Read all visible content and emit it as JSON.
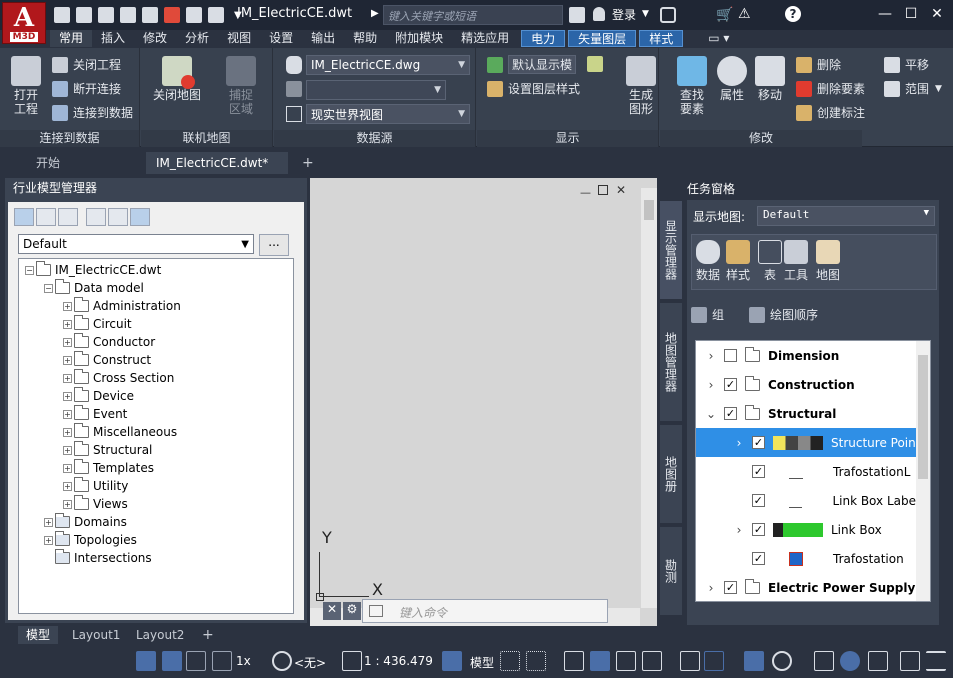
{
  "app": {
    "logo_letter": "A",
    "logo_sub": "M3D",
    "doc_title": "IM_ElectricCE.dwt",
    "search_placeholder": "键入关键字或短语",
    "signin_label": "登录"
  },
  "ribbon_tabs": [
    {
      "label": "常用",
      "active": true
    },
    {
      "label": "插入"
    },
    {
      "label": "修改"
    },
    {
      "label": "分析"
    },
    {
      "label": "视图"
    },
    {
      "label": "设置"
    },
    {
      "label": "输出"
    },
    {
      "label": "帮助"
    },
    {
      "label": "附加模块"
    },
    {
      "label": "精选应用"
    },
    {
      "label": "电力",
      "contextual": true
    },
    {
      "label": "矢量图层",
      "contextual": true
    },
    {
      "label": "样式",
      "contextual": true
    }
  ],
  "ribbon": {
    "connect": {
      "open_project": "打开\n工程",
      "close_project": "关闭工程",
      "disconnect": "断开连接",
      "connect_data": "连接到数据",
      "group_label": "连接到数据"
    },
    "online_map": {
      "close_map": "关闭地图",
      "capture_area": "捕捉\n区域",
      "group_label": "联机地图"
    },
    "datasource": {
      "combo1": "IM_ElectricCE.dwg",
      "combo2": "",
      "combo3": "现实世界视图",
      "group_label": "数据源"
    },
    "display": {
      "default_display": "默认显示模",
      "set_layer_style": "设置图层样式",
      "generate_graph": "生成\n图形",
      "group_label": "显示"
    },
    "modify": {
      "find_feature": "查找\n要素",
      "properties": "属性",
      "move": "移动",
      "delete": "删除",
      "delete_feature": "删除要素",
      "create_annotation": "创建标注",
      "pan": "平移",
      "range": "范围",
      "group_label": "修改"
    }
  },
  "doc_tabs": [
    {
      "label": "开始"
    },
    {
      "label": "IM_ElectricCE.dwt*",
      "active": true
    }
  ],
  "left_panel": {
    "title": "行业模型管理器",
    "select_value": "Default",
    "more_button": "...",
    "tree": [
      {
        "label": "IM_ElectricCE.dwt",
        "level": 0,
        "type": "doc"
      },
      {
        "label": "Data model",
        "level": 1,
        "type": "folder"
      },
      {
        "label": "Administration",
        "level": 2,
        "type": "folder"
      },
      {
        "label": "Circuit",
        "level": 2,
        "type": "folder"
      },
      {
        "label": "Conductor",
        "level": 2,
        "type": "folder"
      },
      {
        "label": "Construct",
        "level": 2,
        "type": "folder"
      },
      {
        "label": "Cross Section",
        "level": 2,
        "type": "folder"
      },
      {
        "label": "Device",
        "level": 2,
        "type": "folder"
      },
      {
        "label": "Event",
        "level": 2,
        "type": "folder"
      },
      {
        "label": "Miscellaneous",
        "level": 2,
        "type": "folder"
      },
      {
        "label": "Structural",
        "level": 2,
        "type": "folder"
      },
      {
        "label": "Templates",
        "level": 2,
        "type": "folder"
      },
      {
        "label": "Utility",
        "level": 2,
        "type": "folder"
      },
      {
        "label": "Views",
        "level": 2,
        "type": "folder"
      },
      {
        "label": "Domains",
        "level": 1,
        "type": "special"
      },
      {
        "label": "Topologies",
        "level": 1,
        "type": "special"
      },
      {
        "label": "Intersections",
        "level": 1,
        "type": "special"
      }
    ]
  },
  "drawing": {
    "ucs_y": "Y",
    "ucs_x": "X",
    "command_placeholder": "键入命令"
  },
  "right_panel": {
    "title": "任务窗格",
    "display_map_label": "显示地图:",
    "display_map_value": "Default",
    "vtabs": [
      "显示管理器",
      "地图管理器",
      "地图册",
      "勘测"
    ],
    "toolbar": [
      "数据",
      "样式",
      "表",
      "工具",
      "地图"
    ],
    "group_label": "组",
    "draw_order_label": "绘图顺序",
    "layers": [
      {
        "label": "Dimension",
        "bold": true,
        "caret": ">",
        "checked": false
      },
      {
        "label": "Construction",
        "bold": true,
        "caret": ">",
        "checked": true
      },
      {
        "label": "Structural",
        "bold": true,
        "caret": "v",
        "checked": true
      },
      {
        "label": "Structure Poin",
        "caret": ">",
        "checked": true,
        "selected": true
      },
      {
        "label": "TrafostationL",
        "checked": true
      },
      {
        "label": "Link Box Labe",
        "checked": true
      },
      {
        "label": "Link Box",
        "caret": ">",
        "checked": true
      },
      {
        "label": "Trafostation",
        "checked": true
      },
      {
        "label": "Electric Power Supply",
        "bold": true,
        "caret": ">",
        "checked": true
      }
    ]
  },
  "layout_tabs": [
    {
      "label": "模型",
      "active": true
    },
    {
      "label": "Layout1"
    },
    {
      "label": "Layout2"
    }
  ],
  "statusbar": {
    "zoom": "1x",
    "ucs": "<无>",
    "scale": "1 : 436.479",
    "model_label": "模型"
  },
  "colors": {
    "accent": "#2f8fe6",
    "brand_red": "#b1181c",
    "ribbon_bg": "#38414f"
  }
}
